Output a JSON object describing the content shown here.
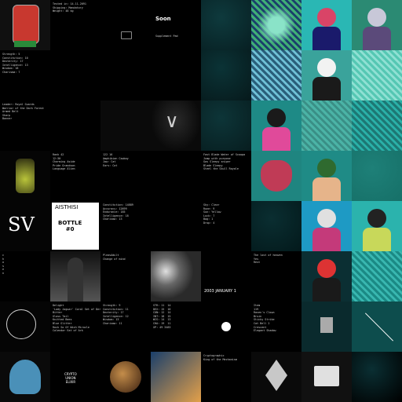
{
  "gallery": {
    "tiles": [
      {
        "style": "portrait",
        "colors": [
          "#101010",
          "#c8382f",
          "#2a8a3a"
        ]
      },
      {
        "style": "text",
        "text": [
          "Tested in: 14.11.2091",
          "Shipping: Mandatory",
          "Weight: 48 kg"
        ]
      },
      {
        "style": "chest-icon",
        "colors": [
          "#000",
          "#8a8a8a"
        ]
      },
      {
        "style": "title",
        "text": [
          "Soon"
        ],
        "sub": [
          "Supplement Pad"
        ]
      },
      {
        "style": "gradient",
        "colors": [
          "#0e3a3d",
          "#071f22"
        ]
      },
      {
        "style": "pattern",
        "colors": [
          "#3fae76",
          "#1a3e6b",
          "#8ae3c8"
        ]
      },
      {
        "style": "character",
        "colors": [
          "#2ab7b4",
          "#d94467",
          "#1a1a6b"
        ]
      },
      {
        "style": "character",
        "colors": [
          "#2b8a73",
          "#c8c8d8",
          "#5b4a7a"
        ]
      },
      {
        "style": "text",
        "text": [
          "Strength: 5",
          "Constitution: 10",
          "Dexterity: 17",
          "Intelligence: 13",
          "Wisdom: 18",
          "Charisma: 7"
        ]
      },
      {
        "style": "text",
        "text": []
      },
      {
        "style": "text",
        "text": []
      },
      {
        "style": "text",
        "text": []
      },
      {
        "style": "gradient",
        "colors": [
          "#0b3336",
          "#06191b"
        ]
      },
      {
        "style": "pattern",
        "colors": [
          "#2a5f7a",
          "#6fc0d6"
        ]
      },
      {
        "style": "character",
        "colors": [
          "#3aa39b",
          "#f2f2f2",
          "#1a1a1a"
        ]
      },
      {
        "style": "pattern",
        "colors": [
          "#55c7b3",
          "#8fe0d3"
        ]
      },
      {
        "style": "text",
        "text": [
          "Leader: Royal Guards",
          "Warrior of the Dark Forest",
          "Armed Belt",
          "Sharp",
          "Banner"
        ]
      },
      {
        "style": "text",
        "text": []
      },
      {
        "style": "dark",
        "colors": [
          "#0a0a0a"
        ]
      },
      {
        "style": "wings",
        "colors": [
          "#0a0a0a",
          "#cfcfcf"
        ]
      },
      {
        "style": "gradient",
        "colors": [
          "#0d3538",
          "#071d1f"
        ]
      },
      {
        "style": "character",
        "colors": [
          "#1e8a86",
          "#1a1a1a",
          "#e04a9a"
        ]
      },
      {
        "style": "pattern",
        "colors": [
          "#4bb3a6",
          "#3a8f86"
        ]
      },
      {
        "style": "pattern",
        "colors": [
          "#1d7874",
          "#2ab0a8"
        ]
      },
      {
        "style": "jar",
        "colors": [
          "#050505",
          "#b9c43a"
        ]
      },
      {
        "style": "text",
        "text": [
          "Rank 42",
          "12:30",
          "Charming Aside",
          "Pride Grandson",
          "Language Alien"
        ]
      },
      {
        "style": "text",
        "text": [
          "122 16",
          "Amphibian Cowboy",
          "Jaw: Cat",
          "Ears: Cat"
        ]
      },
      {
        "style": "text",
        "text": []
      },
      {
        "style": "text",
        "text": [
          "Fast Blade Water of Scoopa",
          "Jump with purpose",
          "Gas Sleepy sniper",
          "Blade Sleepy",
          "Steel the Skull Royale"
        ]
      },
      {
        "style": "mask",
        "colors": [
          "#1f8580",
          "#c03b56",
          "#111"
        ]
      },
      {
        "style": "character",
        "colors": [
          "#1f8b86",
          "#2f6a2f",
          "#e6b48a"
        ]
      },
      {
        "style": "gradient",
        "colors": [
          "#1e8078",
          "#167068"
        ]
      },
      {
        "style": "logo",
        "text": [
          "SV"
        ],
        "colors": [
          "#050505",
          "#ffffff"
        ]
      },
      {
        "style": "bottle",
        "text": [
          "AISTHISI",
          "BOTTLE",
          "#0"
        ],
        "colors": [
          "#000",
          "#fff"
        ]
      },
      {
        "style": "text",
        "text": [
          "Constitution: 14889",
          "Accuracy: 12699",
          "Endurance: 185",
          "Intelligence: 18",
          "Charisma: 13"
        ]
      },
      {
        "style": "text",
        "text": []
      },
      {
        "style": "text",
        "text": [
          "Sky: Clear",
          "Rune: 9",
          "Sun: Yellow",
          "Luck: 7",
          "Bag: 1",
          "Drop: 4"
        ]
      },
      {
        "style": "gradient",
        "colors": [
          "#0a2e31",
          "#03191b"
        ]
      },
      {
        "style": "character",
        "colors": [
          "#1e9ac4",
          "#e0e0e0",
          "#c43a7a"
        ]
      },
      {
        "style": "character",
        "colors": [
          "#2bb3ad",
          "#222",
          "#c8d85a"
        ]
      },
      {
        "style": "text",
        "text": [
          "c",
          "h",
          "o",
          "s",
          "e",
          "n"
        ]
      },
      {
        "style": "figure",
        "colors": [
          "#111",
          "#555"
        ]
      },
      {
        "style": "text",
        "text": [
          "PleasAdult",
          "Change of mind"
        ]
      },
      {
        "style": "clouds",
        "colors": [
          "#2a2a2a",
          "#e0e0e0"
        ]
      },
      {
        "style": "date",
        "text": [
          "2003 JANUARY 1"
        ]
      },
      {
        "style": "text",
        "text": [
          "The lost of heaven",
          "Yes",
          "Rest"
        ]
      },
      {
        "style": "character",
        "colors": [
          "#0b2f33",
          "#d33",
          "#1a1a1a"
        ]
      },
      {
        "style": "pattern",
        "colors": [
          "#1b8a85",
          "#39b7b0"
        ]
      },
      {
        "style": "line-art",
        "colors": [
          "#050505",
          "#cfcfcf"
        ]
      },
      {
        "style": "text",
        "text": [
          "Delight",
          "'Lady Jaguar' Coral Set of Derealize",
          "Bitter",
          "Gloss Tail",
          "Knitted Bees",
          "Blue Glitter",
          "Rock So Of Wish Miracle",
          "Calendar Eat of Ark"
        ]
      },
      {
        "style": "text",
        "text": [
          "Strength: 9",
          "Constitution: 11",
          "Dexterity: 17",
          "Intelligence: 12",
          "Wisdom: 13",
          "Charisma: 11"
        ]
      },
      {
        "style": "text",
        "text": [
          "STR: 11  14",
          "DEX: 15  16",
          "CON: 12  14",
          "INT: 18  15",
          "WIS: 14  13",
          "CHA: 19  11",
          "XP: 49 3483"
        ]
      },
      {
        "style": "orb",
        "colors": [
          "#000",
          "#fff"
        ]
      },
      {
        "style": "text",
        "text": [
          "Item",
          "119",
          "Raven's Clown",
          "Bruin",
          "Sticky Strike",
          "Cat Bell 2",
          "Crescent",
          "Elegant Shadow"
        ]
      },
      {
        "style": "robot",
        "colors": [
          "#0a2a2d",
          "#aaa"
        ]
      },
      {
        "style": "needle",
        "colors": [
          "#0d4d4d",
          "#fff"
        ]
      },
      {
        "style": "crest",
        "colors": [
          "#0a0a0a",
          "#4a90b8"
        ]
      },
      {
        "style": "poster",
        "text": [
          "CRYPTO",
          "UNION",
          "ELIXIR"
        ],
        "colors": [
          "#000",
          "#c8d0e0"
        ]
      },
      {
        "style": "planet",
        "colors": [
          "#000",
          "#c48d4a"
        ]
      },
      {
        "style": "scene",
        "colors": [
          "#1a3f6b",
          "#e3a04a"
        ]
      },
      {
        "style": "text",
        "text": [
          "Cryptographic",
          "King of the Mechanism"
        ]
      },
      {
        "style": "diamond",
        "colors": [
          "#0a0a0a",
          "#c8c8c8"
        ]
      },
      {
        "style": "cube",
        "colors": [
          "#111",
          "#e0e0e0"
        ]
      },
      {
        "style": "gradient",
        "colors": [
          "#0a2f33",
          "#000"
        ]
      }
    ]
  }
}
